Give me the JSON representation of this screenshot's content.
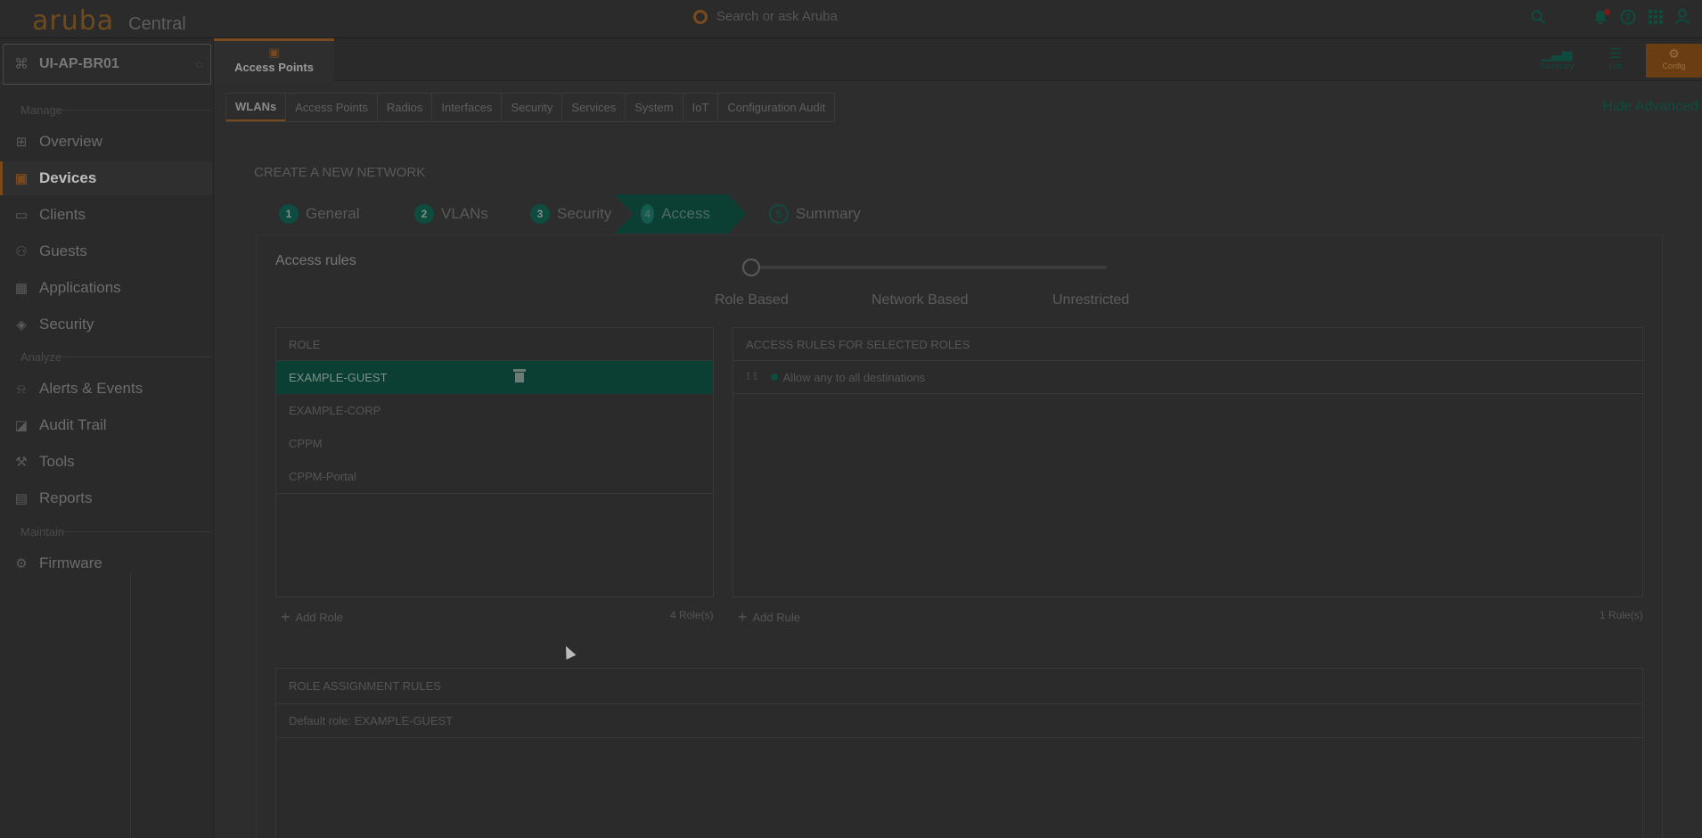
{
  "topbar": {
    "brand": "aruba",
    "product": "Central",
    "search_placeholder": "Search or ask Aruba",
    "icons": [
      "search-icon",
      "bell-icon",
      "help-icon",
      "apps-grid-icon",
      "user-icon"
    ]
  },
  "sidebar": {
    "device_name": "UI-AP-BR01",
    "sections": {
      "manage": "Manage",
      "analyze": "Analyze",
      "maintain": "Maintain"
    },
    "items": [
      {
        "label": "Overview",
        "icon": "grid-icon"
      },
      {
        "label": "Devices",
        "icon": "devices-icon",
        "active": true
      },
      {
        "label": "Clients",
        "icon": "clients-icon"
      },
      {
        "label": "Guests",
        "icon": "guests-icon"
      },
      {
        "label": "Applications",
        "icon": "applications-icon"
      },
      {
        "label": "Security",
        "icon": "shield-icon"
      },
      {
        "label": "Alerts & Events",
        "icon": "bell-icon"
      },
      {
        "label": "Audit Trail",
        "icon": "audit-icon"
      },
      {
        "label": "Tools",
        "icon": "wrench-icon"
      },
      {
        "label": "Reports",
        "icon": "reports-icon"
      },
      {
        "label": "Firmware",
        "icon": "firmware-icon"
      }
    ]
  },
  "header": {
    "active_tab": "Access Points",
    "views": {
      "summary": "Summary",
      "list": "List",
      "config": "Config"
    }
  },
  "subtabs": [
    "WLANs",
    "Access Points",
    "Radios",
    "Interfaces",
    "Security",
    "Services",
    "System",
    "IoT",
    "Configuration Audit"
  ],
  "hide_advanced": "Hide Advanced",
  "wizard": {
    "title": "CREATE A NEW NETWORK",
    "steps": [
      {
        "num": "1",
        "label": "General"
      },
      {
        "num": "2",
        "label": "VLANs"
      },
      {
        "num": "3",
        "label": "Security"
      },
      {
        "num": "4",
        "label": "Access"
      },
      {
        "num": "5",
        "label": "Summary"
      }
    ]
  },
  "access": {
    "label": "Access rules",
    "options": [
      "Role Based",
      "Network Based",
      "Unrestricted"
    ],
    "selected_option": "Role Based"
  },
  "roles": {
    "header": "ROLE",
    "items": [
      "EXAMPLE-GUEST",
      "EXAMPLE-CORP",
      "CPPM",
      "CPPM-Portal"
    ],
    "selected": "EXAMPLE-GUEST",
    "add_label": "Add Role",
    "count": "4 Role(s)"
  },
  "rules": {
    "header": "ACCESS RULES FOR SELECTED ROLES",
    "items": [
      "Allow any to all destinations"
    ],
    "add_label": "Add Rule",
    "count": "1 Rule(s)"
  },
  "assignment": {
    "header": "ROLE ASSIGNMENT RULES",
    "default_role": "Default role: EXAMPLE-GUEST"
  },
  "colors": {
    "accent_orange": "#7a4a1f",
    "accent_green": "#0d4c3f"
  }
}
